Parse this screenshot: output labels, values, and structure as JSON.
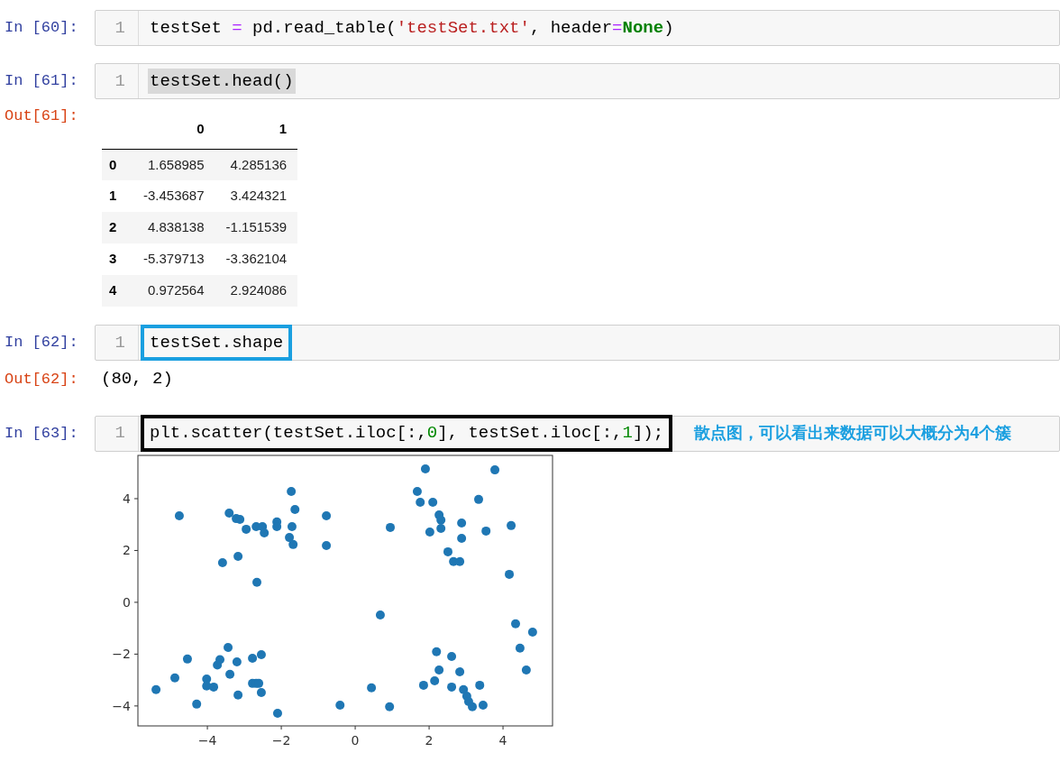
{
  "cells": [
    {
      "kind": "input",
      "prompt": "In [60]:",
      "line_number": "1",
      "selected": false,
      "framed": false,
      "tokens": [
        {
          "kind": "plain",
          "text": "testSet "
        },
        {
          "kind": "op",
          "text": "="
        },
        {
          "kind": "plain",
          "text": " pd.read_table("
        },
        {
          "kind": "string",
          "text": "'testSet.txt'"
        },
        {
          "kind": "plain",
          "text": ", header"
        },
        {
          "kind": "op",
          "text": "="
        },
        {
          "kind": "keyword",
          "text": "None"
        },
        {
          "kind": "plain",
          "text": ")"
        }
      ]
    },
    {
      "kind": "input",
      "prompt": "In [61]:",
      "line_number": "1",
      "selected": true,
      "framed": false,
      "tokens": [
        {
          "kind": "plain",
          "text": "testSet.head()"
        }
      ]
    },
    {
      "kind": "table_output",
      "prompt": "Out[61]:",
      "columns": [
        "0",
        "1"
      ],
      "rows": [
        {
          "index": "0",
          "cells": [
            "1.658985",
            "4.285136"
          ]
        },
        {
          "index": "1",
          "cells": [
            "-3.453687",
            "3.424321"
          ]
        },
        {
          "index": "2",
          "cells": [
            "4.838138",
            "-1.151539"
          ]
        },
        {
          "index": "3",
          "cells": [
            "-5.379713",
            "-3.362104"
          ]
        },
        {
          "index": "4",
          "cells": [
            "0.972564",
            "2.924086"
          ]
        }
      ]
    },
    {
      "kind": "input",
      "prompt": "In [62]:",
      "line_number": "1",
      "selected": false,
      "framed": true,
      "color": "#1a9fe0",
      "tokens": [
        {
          "kind": "plain",
          "text": "testSet.shape"
        }
      ]
    },
    {
      "kind": "text_output",
      "prompt": "Out[62]:",
      "text": "(80, 2)"
    },
    {
      "kind": "input",
      "prompt": "In [63]:",
      "line_number": "1",
      "selected": false,
      "framed": true,
      "color": "#000000",
      "note": "散点图，可以看出来数据可以大概分为4个簇",
      "tokens": [
        {
          "kind": "plain",
          "text": "plt.scatter(testSet.iloc[:,"
        },
        {
          "kind": "number",
          "text": "0"
        },
        {
          "kind": "plain",
          "text": "], testSet.iloc[:,"
        },
        {
          "kind": "number",
          "text": "1"
        },
        {
          "kind": "plain",
          "text": "]);"
        }
      ]
    },
    {
      "kind": "chart_output",
      "chart_data": {
        "type": "scatter",
        "xlim": [
          -5.88,
          5.34
        ],
        "ylim": [
          -4.77,
          5.67
        ],
        "xticks": [
          {
            "value": -4,
            "label": "−4"
          },
          {
            "value": -2,
            "label": "−2"
          },
          {
            "value": 0,
            "label": "0"
          },
          {
            "value": 2,
            "label": "2"
          },
          {
            "value": 4,
            "label": "4"
          }
        ],
        "yticks": [
          {
            "value": -4,
            "label": "−4"
          },
          {
            "value": -2,
            "label": "−2"
          },
          {
            "value": 0,
            "label": "0"
          },
          {
            "value": 2,
            "label": "2"
          },
          {
            "value": 4,
            "label": "4"
          }
        ],
        "series": [
          {
            "color": "#1f77b4",
            "x": [
              -4.76,
              -3.41,
              -3.22,
              -3.12,
              -2.95,
              -2.68,
              -2.51,
              -2.46,
              -2.12,
              -2.12,
              -1.73,
              -1.63,
              -1.71,
              -1.78,
              -1.68,
              -3.59,
              -3.17,
              -2.66,
              -0.78,
              -0.78,
              -5.39,
              -4.88,
              -4.54,
              -4.29,
              -4.02,
              -4.02,
              -3.83,
              -3.73,
              -3.66,
              -3.44,
              -3.39,
              -3.2,
              -3.17,
              -2.78,
              -2.78,
              -2.68,
              -2.61,
              -2.54,
              -2.54,
              -2.1,
              -0.41,
              1.9,
              3.78,
              1.68,
              1.76,
              2.1,
              3.34,
              2.27,
              2.32,
              2.32,
              2.88,
              2.02,
              0.95,
              3.54,
              4.22,
              2.88,
              2.51,
              2.66,
              2.83,
              4.17,
              0.68,
              4.34,
              4.8,
              4.46,
              4.63,
              2.2,
              2.61,
              2.27,
              2.83,
              2.15,
              1.85,
              2.61,
              2.93,
              3.37,
              3.02,
              3.07,
              3.17,
              3.46,
              0.44,
              0.93
            ],
            "values": [
              3.34,
              3.44,
              3.23,
              3.2,
              2.82,
              2.92,
              2.92,
              2.68,
              3.1,
              2.92,
              4.28,
              3.58,
              2.92,
              2.5,
              2.23,
              1.53,
              1.77,
              0.77,
              3.34,
              2.19,
              -3.37,
              -2.92,
              -2.19,
              -3.93,
              -2.96,
              -3.23,
              -3.27,
              -2.42,
              -2.21,
              -1.74,
              -2.78,
              -2.3,
              -3.58,
              -2.16,
              -3.13,
              -3.13,
              -3.13,
              -2.02,
              -3.48,
              -4.28,
              -3.97,
              5.15,
              5.11,
              4.28,
              3.86,
              3.86,
              3.97,
              3.37,
              3.17,
              2.85,
              3.06,
              2.71,
              2.89,
              2.75,
              2.96,
              2.47,
              1.95,
              1.57,
              1.57,
              1.08,
              -0.49,
              -0.83,
              -1.15,
              -1.77,
              -2.61,
              -1.91,
              -2.09,
              -2.61,
              -2.68,
              -3.03,
              -3.2,
              -3.27,
              -3.37,
              -3.2,
              -3.62,
              -3.83,
              -4.03,
              -3.97,
              -3.3,
              -4.03
            ]
          }
        ]
      }
    }
  ]
}
